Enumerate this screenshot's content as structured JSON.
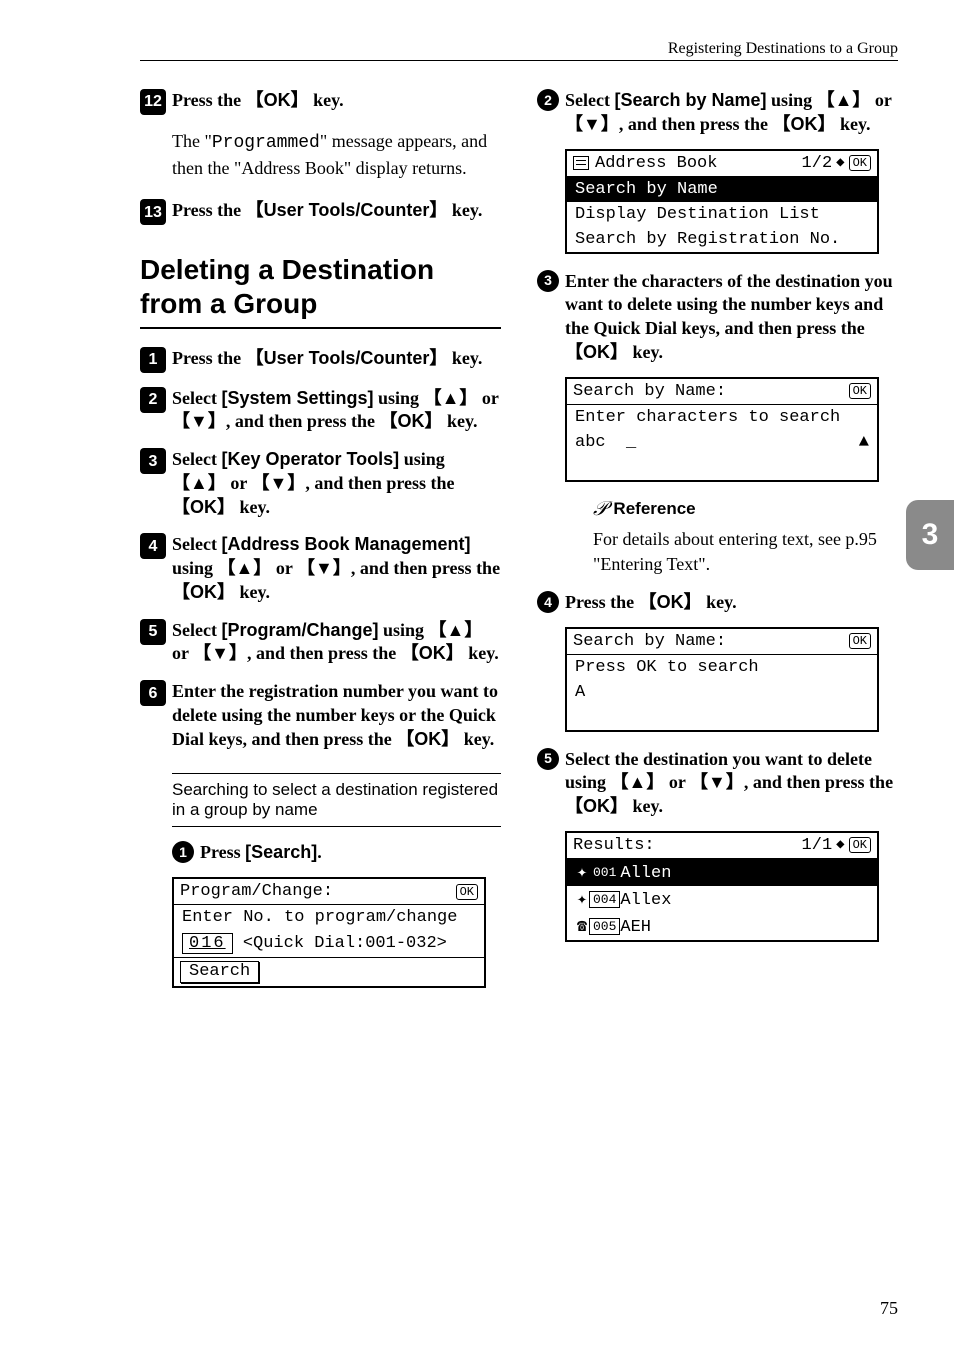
{
  "runningHead": "Registering Destinations to a Group",
  "sideTab": "3",
  "pageNumber": "75",
  "left": {
    "step12": {
      "n": "12",
      "pre": "Press the ",
      "key": "OK",
      "post": " key."
    },
    "step12_explain_a": "The \"",
    "step12_explain_mono": "Programmed",
    "step12_explain_b": "\" message appears, and then the \"Address Book\" display returns.",
    "step13": {
      "n": "13",
      "pre": "Press the ",
      "key": "User Tools/Counter",
      "post": " key."
    },
    "h2": "Deleting a Destination from a Group",
    "stepsA": {
      "s1": {
        "n": "1",
        "pre": "Press the ",
        "key": "User Tools/Counter",
        "post": " key."
      },
      "s2": {
        "n": "2",
        "pre": "Select ",
        "label": "[System Settings]",
        "mid": " using ",
        "k1": "▲",
        "or": " or ",
        "k2": "▼",
        "mid2": ", and then press the ",
        "kok": "OK",
        "post": " key."
      },
      "s3": {
        "n": "3",
        "pre": "Select ",
        "label": "[Key Operator Tools]",
        "mid": " using ",
        "k1": "▲",
        "or": " or ",
        "k2": "▼",
        "mid2": ", and then press the ",
        "kok": "OK",
        "post": " key."
      },
      "s4": {
        "n": "4",
        "pre": "Select ",
        "label": "[Address Book Management]",
        "mid": " using ",
        "k1": "▲",
        "or": " or ",
        "k2": "▼",
        "mid2": ", and then press ",
        "the": "the ",
        "kok": "OK",
        "post": " key."
      },
      "s5": {
        "n": "5",
        "pre": "Select ",
        "label": "[Program/Change]",
        "mid": " using ",
        "k1": "▲",
        "or": " or ",
        "k2": "▼",
        "mid2": ", and then press the ",
        "kok": "OK",
        "post": " key."
      },
      "s6": {
        "n": "6",
        "text_a": "Enter the registration number you want to delete using the number keys or the Quick Dial keys, and then press the ",
        "kok": "OK",
        "text_b": " key."
      }
    },
    "subSectionTitle": "Searching to select a destination registered in a group by name",
    "sub1": {
      "n": "1",
      "pre": "Press ",
      "label": "[Search]",
      "post": "."
    },
    "lcdA": {
      "title": "Program/Change:",
      "ok": "OK",
      "line2": "Enter No. to program/change",
      "inputVal": "016",
      "quick": "<Quick Dial:001-032>",
      "searchBtn": "Search"
    }
  },
  "right": {
    "sub2": {
      "n": "2",
      "pre": "Select ",
      "label": "[Search by Name]",
      "mid": " using ",
      "k1": "▲",
      "or": " or ",
      "k2": "▼",
      "mid2": ", and then press the ",
      "kok": "OK",
      "post": " key."
    },
    "lcdB": {
      "title": "Address Book",
      "page": "1/2",
      "ok": "OK",
      "row1": "Search by Name",
      "row2": "Display Destination List",
      "row3": "Search by Registration No."
    },
    "sub3": {
      "n": "3",
      "text_a": "Enter the characters of the destination you want to delete using the number keys and the Quick Dial keys, and then press the ",
      "kok": "OK",
      "text_b": " key."
    },
    "lcdC": {
      "title": "Search by Name:",
      "ok": "OK",
      "line2": "Enter characters to search",
      "mode": "abc",
      "cursor": "_",
      "arrow": "▲"
    },
    "refLabel": "Reference",
    "refBody": "For details about entering text, see p.95 \"Entering Text\".",
    "sub4": {
      "n": "4",
      "pre": "Press the ",
      "kok": "OK",
      "post": " key."
    },
    "lcdD": {
      "title": "Search by Name:",
      "ok": "OK",
      "line2": "Press OK to search",
      "value": "A"
    },
    "sub5": {
      "n": "5",
      "text_a": "Select the destination you want to delete using ",
      "k1": "▲",
      "or": " or ",
      "k2": "▼",
      "mid2": ", and then press the ",
      "kok": "OK",
      "post": " key."
    },
    "lcdE": {
      "title": "Results:",
      "page": "1/1",
      "ok": "OK",
      "r1": {
        "badge": "001",
        "name": "Allen"
      },
      "r2": {
        "badge": "004",
        "name": "Allex"
      },
      "r3": {
        "badge": "005",
        "name": "AEH"
      }
    }
  }
}
